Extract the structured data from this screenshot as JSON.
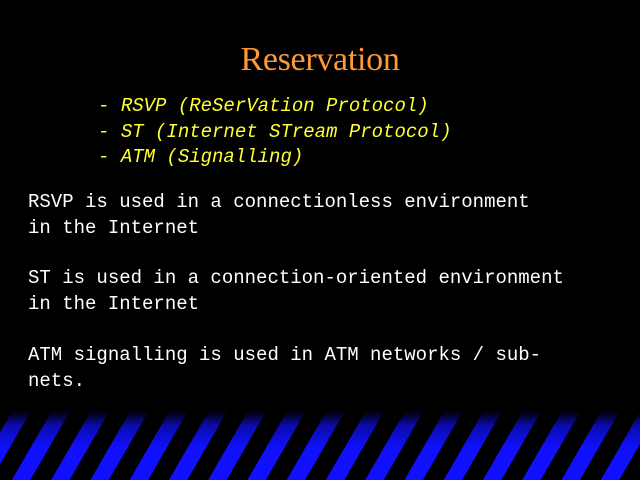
{
  "slide": {
    "title": "Reservation",
    "bullets": [
      {
        "dash": "- ",
        "text": "RSVP (ReSerVation Protocol)"
      },
      {
        "dash": "- ",
        "text": "ST (Internet STream Protocol)"
      },
      {
        "dash": "- ",
        "text": "ATM (Signalling)"
      }
    ],
    "paragraphs": [
      "RSVP is used in a connectionless environment\nin the Internet",
      "ST is used in a connection-oriented environment\nin the Internet",
      "ATM signalling is used in ATM networks / sub-\nnets."
    ]
  },
  "colors": {
    "background": "#000000",
    "title": "#ff9933",
    "bullets": "#ffff33",
    "body": "#ffffff",
    "stripes": "#1010ff"
  }
}
